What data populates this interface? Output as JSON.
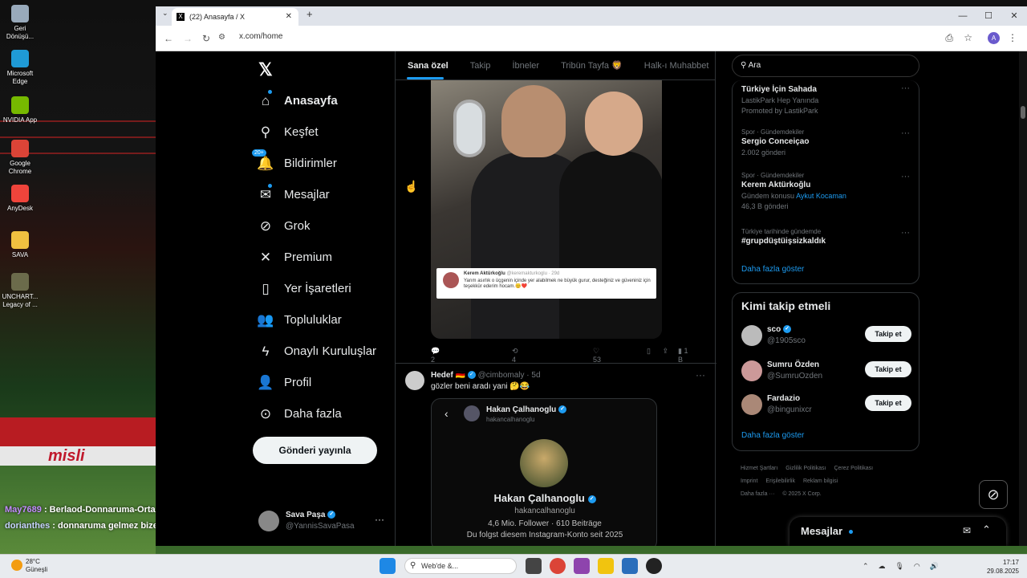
{
  "desktop": {
    "icons": [
      {
        "label": "Geri Dönüşü...",
        "icon": "recycle-bin-icon",
        "color": "#9ab"
      },
      {
        "label": "Microsoft Edge",
        "icon": "edge-icon",
        "color": "#1f9ad6"
      },
      {
        "label": "NVIDIA App",
        "icon": "nvidia-icon",
        "color": "#76b900"
      },
      {
        "label": "Google Chrome",
        "icon": "chrome-icon",
        "color": "#db4437"
      },
      {
        "label": "AnyDesk",
        "icon": "anydesk-icon",
        "color": "#ef443b"
      },
      {
        "label": "SAVA",
        "icon": "folder-icon",
        "color": "#f0c040"
      },
      {
        "label": "UNCHART... Legacy of ...",
        "icon": "game-icon",
        "color": "#6b6b4b"
      }
    ],
    "chat": [
      {
        "user": "May7689",
        "message": ": Berlaod-Donnaruma-Orta saha hadi"
      },
      {
        "user": "dorianthes",
        "message": ": donnaruma gelmez bize ocağa kadar oynamaz"
      }
    ],
    "banner_text": "misli"
  },
  "browser": {
    "tab_title": "(22) Anasayfa / X",
    "url": "x.com/home",
    "avatar_letter": "A"
  },
  "nav": {
    "items": [
      {
        "label": "Anasayfa",
        "icon": "home-icon",
        "glyph": "⌂"
      },
      {
        "label": "Keşfet",
        "icon": "search-icon",
        "glyph": "⚲"
      },
      {
        "label": "Bildirimler",
        "icon": "bell-icon",
        "glyph": "🔔",
        "badge": "20+"
      },
      {
        "label": "Mesajlar",
        "icon": "mail-icon",
        "glyph": "✉"
      },
      {
        "label": "Grok",
        "icon": "grok-icon",
        "glyph": "⊘"
      },
      {
        "label": "Premium",
        "icon": "x-icon",
        "glyph": "✕"
      },
      {
        "label": "Yer İşaretleri",
        "icon": "bookmark-icon",
        "glyph": "▯"
      },
      {
        "label": "Topluluklar",
        "icon": "communities-icon",
        "glyph": "👥"
      },
      {
        "label": "Onaylı Kuruluşlar",
        "icon": "lightning-icon",
        "glyph": "ϟ"
      },
      {
        "label": "Profil",
        "icon": "profile-icon",
        "glyph": "👤"
      },
      {
        "label": "Daha fazla",
        "icon": "more-circle-icon",
        "glyph": "⊙"
      }
    ],
    "post_button": "Gönderi yayınla",
    "account": {
      "name": "Sava Paşa",
      "handle": "@YannisSavaPasa"
    }
  },
  "timeline": {
    "tabs": [
      "Sana özel",
      "Takip",
      "İbneler",
      "Tribün Tayfa 🦁",
      "Halk-ı Muhabbet"
    ],
    "post1": {
      "embedded_author": "Kerem Aktürkoğlu",
      "embedded_meta": "@keremakturkoglu · 29d",
      "embedded_text": "Yarım asırlık o üçgenin içinde yer alabilmek ne büyük gurur, desteğiniz ve güveniniz için teşekkür ederim hocam.😊❤️",
      "replies": "2",
      "reposts": "4",
      "likes": "53",
      "views": "1 B"
    },
    "post2": {
      "name": "Hedef 🇩🇪",
      "handle": "@cimbomaly · 5d",
      "text": "gözler beni aradı yani 🤔😂",
      "card": {
        "name": "Hakan Çalhanoglu",
        "handle": "hakancalhanoglu",
        "stats": "4,6 Mio. Follower · 610 Beiträge",
        "follow_text": "Du folgst diesem Instagram-Konto seit 2025"
      }
    }
  },
  "right": {
    "search_placeholder": "Ara",
    "trends": [
      {
        "category": "",
        "title": "Türkiye İçin Sahada",
        "sub": "LastikPark Hep Yanında",
        "extra": "Promoted by LastikPark",
        "link": ""
      },
      {
        "category": "Spor · Gündemdekiler",
        "title": "Sergio Conceiçao",
        "sub": "2.002 gönderi",
        "extra": "",
        "link": ""
      },
      {
        "category": "Spor · Gündemdekiler",
        "title": "Kerem Aktürkoğlu",
        "sub": "Gündem konusu",
        "link": "Aykut Kocaman",
        "extra": "46,3 B gönderi"
      },
      {
        "category": "Türkiye tarihinde gündemde",
        "title": "#grupdüştüişsizkaldık",
        "sub": "",
        "extra": "",
        "link": ""
      }
    ],
    "show_more": "Daha fazla göster",
    "who_title": "Kimi takip etmeli",
    "who": [
      {
        "name": "sco",
        "handle": "@1905sco",
        "button": "Takip et"
      },
      {
        "name": "Sumru Özden",
        "handle": "@SumruOzden",
        "button": "Takip et"
      },
      {
        "name": "Fardazio",
        "handle": "@bingunixcr",
        "button": "Takip et"
      }
    ],
    "who_more": "Daha fazla göster",
    "footer": [
      "Hizmet Şartları",
      "Gizlilik Politikası",
      "Çerez Politikası",
      "Imprint",
      "Erişilebilirlik",
      "Reklam bilgisi",
      "Daha fazla ···",
      "© 2025 X Corp."
    ],
    "messages_label": "Mesajlar"
  },
  "taskbar": {
    "temp": "28°C",
    "weather": "Güneşli",
    "search_placeholder": "Web'de &...",
    "time": "17:17",
    "date": "29.08.2025"
  }
}
